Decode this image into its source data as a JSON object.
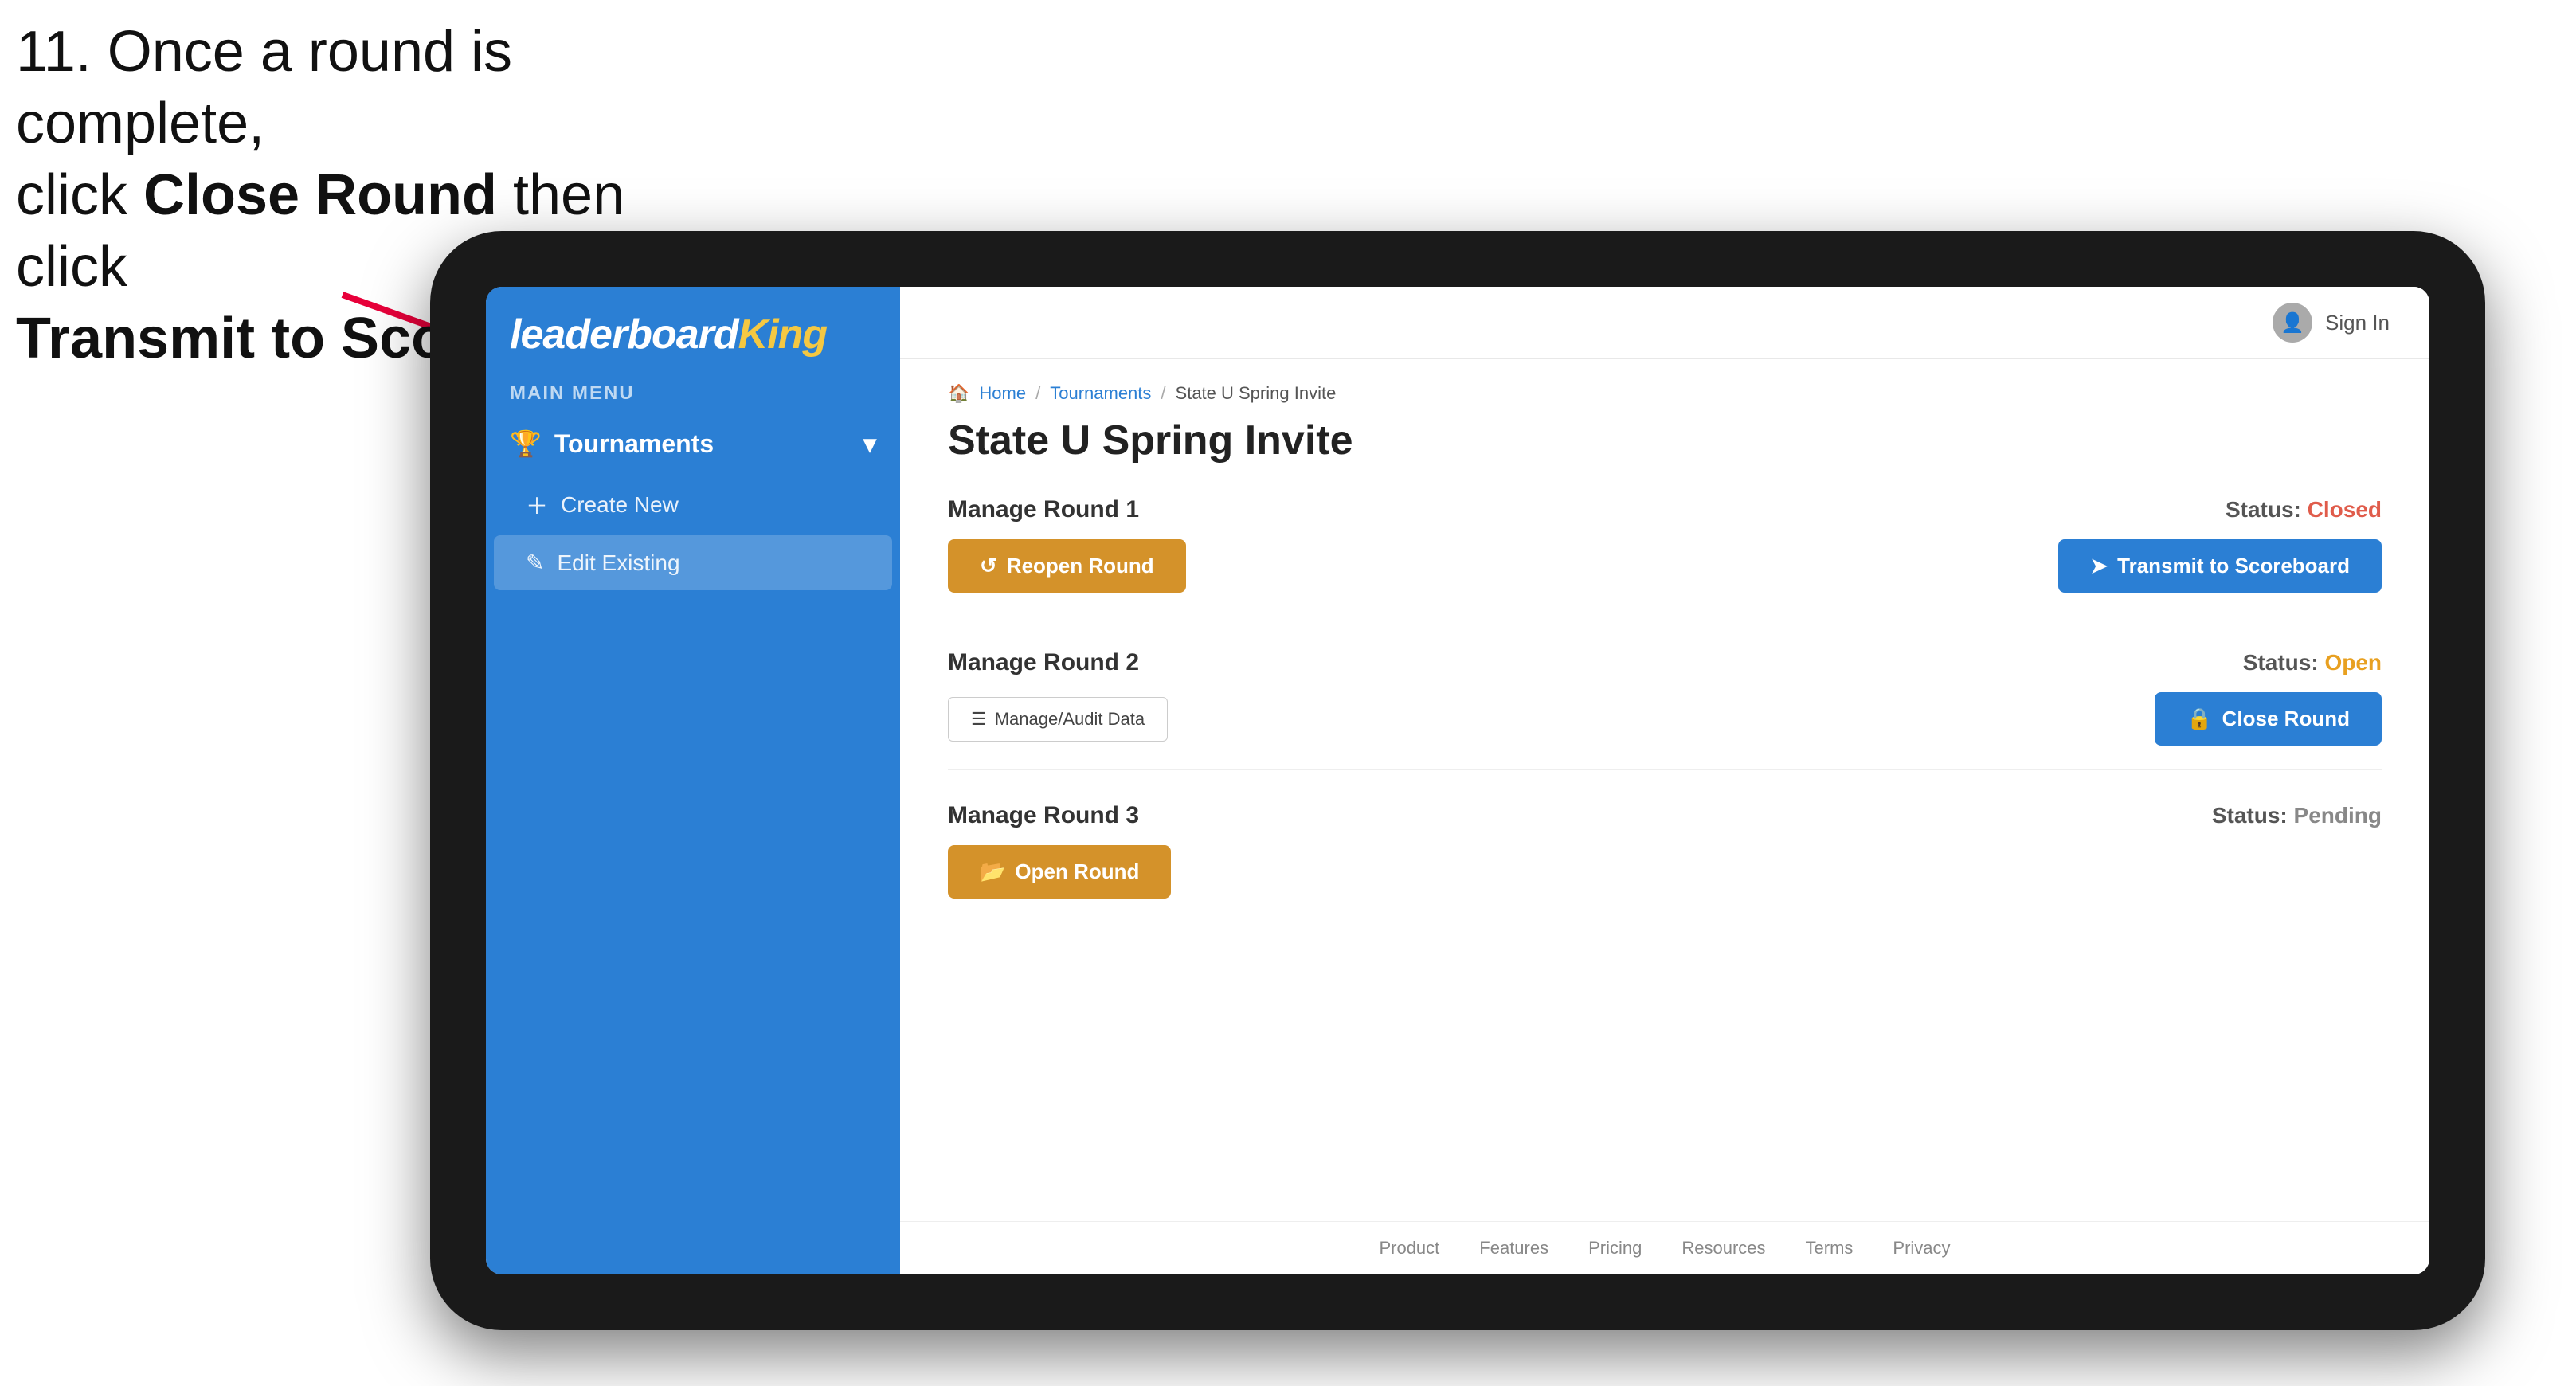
{
  "instruction": {
    "line1": "11. Once a round is complete,",
    "line2": "click ",
    "bold1": "Close Round",
    "line3": " then click",
    "bold2": "Transmit to Scoreboard."
  },
  "sidebar": {
    "logo": {
      "leaderboard": "leaderboard",
      "king": "King"
    },
    "main_menu_label": "MAIN MENU",
    "nav": {
      "tournaments_label": "Tournaments",
      "create_new_label": "Create New",
      "edit_existing_label": "Edit Existing"
    }
  },
  "header": {
    "sign_in_label": "Sign In"
  },
  "breadcrumb": {
    "home": "Home",
    "tournaments": "Tournaments",
    "current": "State U Spring Invite"
  },
  "page": {
    "title": "State U Spring Invite"
  },
  "rounds": [
    {
      "label": "Manage Round 1",
      "status_prefix": "Status:",
      "status_value": "Closed",
      "status_class": "status-closed",
      "button1_label": "Reopen Round",
      "button1_type": "btn-gold",
      "button2_label": "Transmit to Scoreboard",
      "button2_type": "btn-blue",
      "show_manage_audit": false
    },
    {
      "label": "Manage Round 2",
      "status_prefix": "Status:",
      "status_value": "Open",
      "status_class": "status-open",
      "button1_label": null,
      "button2_label": "Close Round",
      "button2_type": "btn-blue",
      "manage_audit_label": "Manage/Audit Data",
      "show_manage_audit": true
    },
    {
      "label": "Manage Round 3",
      "status_prefix": "Status:",
      "status_value": "Pending",
      "status_class": "status-pending",
      "button1_label": "Open Round",
      "button1_type": "btn-gold",
      "button2_label": null,
      "show_manage_audit": false
    }
  ],
  "footer": {
    "links": [
      "Product",
      "Features",
      "Pricing",
      "Resources",
      "Terms",
      "Privacy"
    ]
  }
}
